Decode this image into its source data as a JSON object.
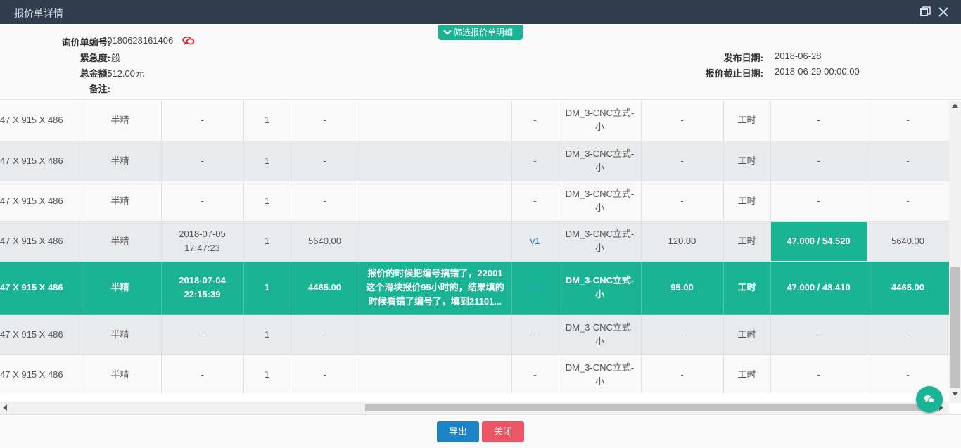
{
  "window": {
    "title": "报价单详情"
  },
  "header": {
    "filter_button": "筛选报价单明细",
    "inquiry_no_label": "询价单编号:",
    "inquiry_no_value": "20180628161406",
    "urgency_label": "紧急度:",
    "urgency_value": "一般",
    "total_label": "总金额:",
    "total_value": "4512.00元",
    "remark_label": "备注:",
    "publish_date_label": "发布日期:",
    "publish_date_value": "2018-06-28",
    "deadline_label": "报价截止日期:",
    "deadline_value": "2018-06-29 00:00:00"
  },
  "rows": [
    {
      "dims": "47 X 915 X 486",
      "level": "半精",
      "time": "-",
      "qty": "1",
      "price": "-",
      "note": "",
      "ver": "-",
      "machine": "DM_3-CNC立式-小",
      "hours": "-",
      "unit": "工时",
      "rate": "-",
      "amount": "-"
    },
    {
      "dims": "47 X 915 X 486",
      "level": "半精",
      "time": "-",
      "qty": "1",
      "price": "-",
      "note": "",
      "ver": "-",
      "machine": "DM_3-CNC立式-小",
      "hours": "-",
      "unit": "工时",
      "rate": "-",
      "amount": "-"
    },
    {
      "dims": "47 X 915 X 486",
      "level": "半精",
      "time": "-",
      "qty": "1",
      "price": "-",
      "note": "",
      "ver": "-",
      "machine": "DM_3-CNC立式-小",
      "hours": "-",
      "unit": "工时",
      "rate": "-",
      "amount": "-"
    },
    {
      "dims": "47 X 915 X 486",
      "level": "半精",
      "time": "2018-07-05 17:47:23",
      "qty": "1",
      "price": "5640.00",
      "note": "",
      "ver": "v1",
      "machine": "DM_3-CNC立式-小",
      "hours": "120.00",
      "unit": "工时",
      "rate": "47.000 / 54.520",
      "amount": "5640.00"
    },
    {
      "dims": "47 X 915 X 486",
      "level": "半精",
      "time": "2018-07-04 22:15:39",
      "qty": "1",
      "price": "4465.00",
      "note": "报价的时候把编号搞错了，22001这个滑块报价95小时的，结果填的时候看错了编号了，填到21101...",
      "ver": "v1",
      "machine": "DM_3-CNC立式-小",
      "hours": "95.00",
      "unit": "工时",
      "rate": "47.000 / 48.410",
      "amount": "4465.00"
    },
    {
      "dims": "47 X 915 X 486",
      "level": "半精",
      "time": "-",
      "qty": "1",
      "price": "-",
      "note": "",
      "ver": "-",
      "machine": "DM_3-CNC立式-小",
      "hours": "-",
      "unit": "工时",
      "rate": "-",
      "amount": "-"
    },
    {
      "dims": "47 X 915 X 486",
      "level": "半精",
      "time": "-",
      "qty": "1",
      "price": "-",
      "note": "",
      "ver": "-",
      "machine": "DM_3-CNC立式-小",
      "hours": "-",
      "unit": "工时",
      "rate": "-",
      "amount": "-"
    }
  ],
  "footer": {
    "export_label": "导出",
    "close_label": "关闭"
  },
  "colors": {
    "accent": "#1ab394",
    "titlebar": "#2f3d4c",
    "export": "#1c84c6",
    "close": "#ed5565"
  },
  "icons": [
    "restore-icon",
    "close-icon",
    "chevron-down-icon",
    "message-icon",
    "chat-icon"
  ]
}
